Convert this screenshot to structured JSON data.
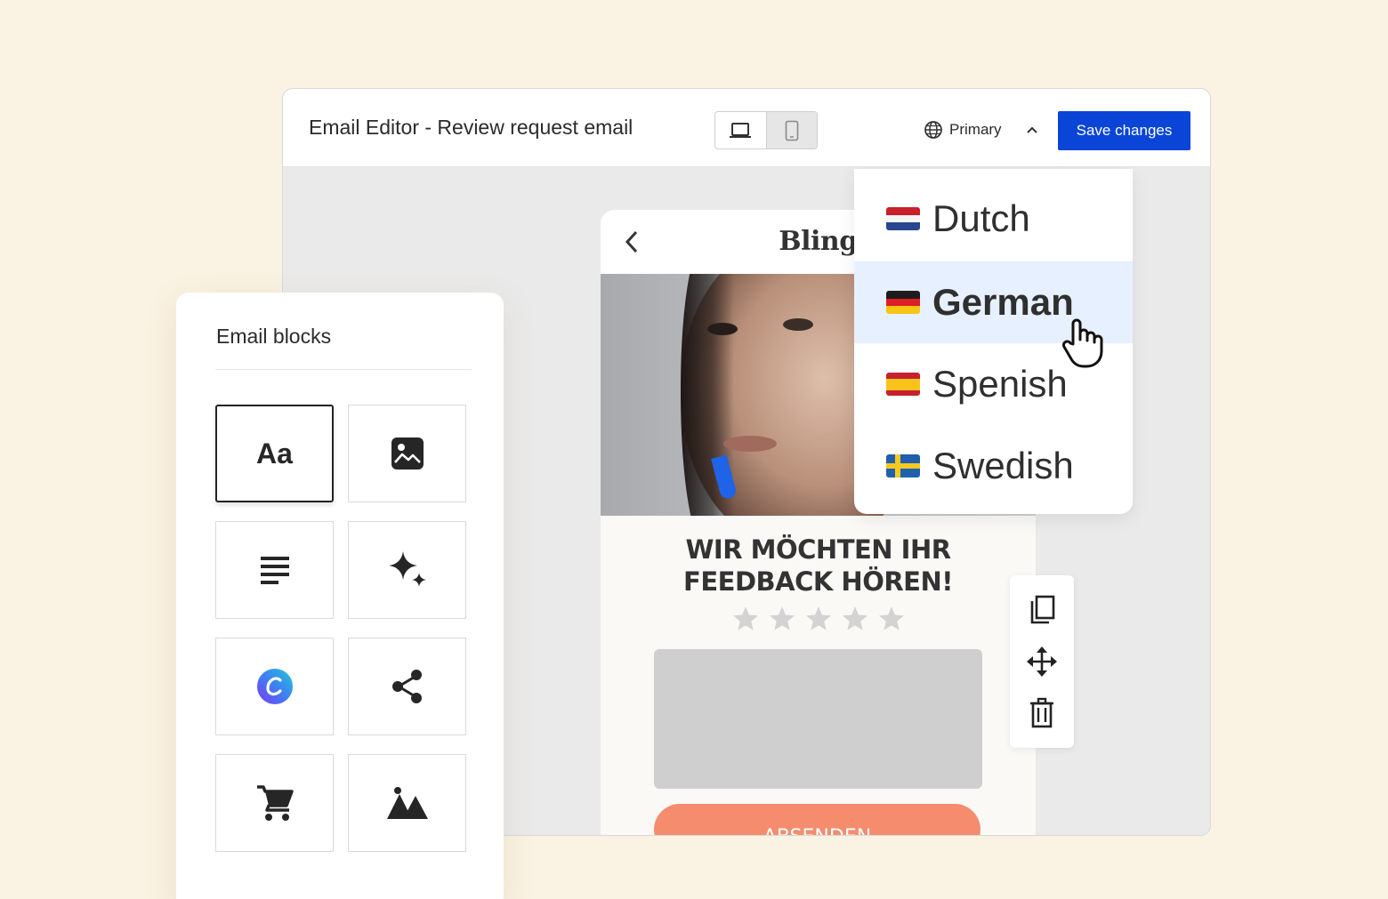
{
  "editor": {
    "title": "Email Editor - Review request email",
    "device_toggle": [
      "desktop-icon",
      "mobile-icon"
    ],
    "language_label": "Primary",
    "save_label": "Save changes"
  },
  "preview": {
    "brand": "Bling",
    "headline_line1": "WIR MÖCHTEN IHR",
    "headline_line2": "FEEDBACK HÖREN!",
    "stars": 5,
    "submit_label": "ABSENDEN"
  },
  "languages": [
    {
      "label": "Dutch",
      "flag": "nl-flag"
    },
    {
      "label": "German",
      "flag": "de-flag",
      "selected": true
    },
    {
      "label": "Spenish",
      "flag": "es-flag"
    },
    {
      "label": "Swedish",
      "flag": "se-flag"
    }
  ],
  "block_tools": [
    "duplicate-icon",
    "move-icon",
    "delete-icon"
  ],
  "blocks_panel": {
    "title": "Email blocks",
    "text_block_label": "Aa",
    "tiles": [
      "text-block",
      "image-block",
      "paragraph-block",
      "ai-block",
      "canva-block",
      "share-block",
      "product-block",
      "gallery-block"
    ]
  },
  "colors": {
    "background": "#faf2e2",
    "accent": "#0a45d8",
    "submit": "#f58c6e",
    "selected_row": "#e6f0fe"
  }
}
